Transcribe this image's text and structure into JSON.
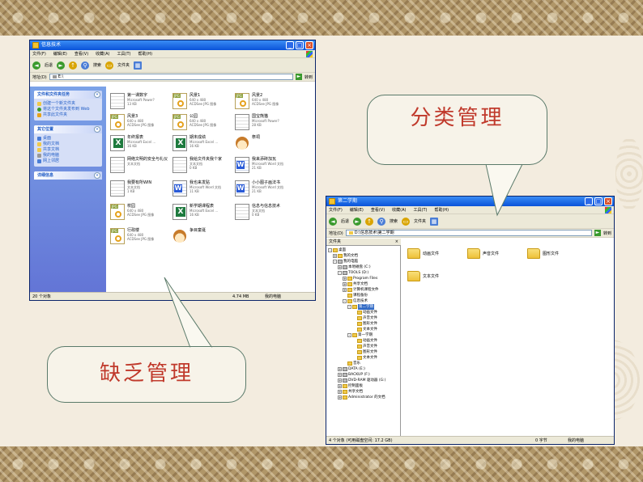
{
  "colors": {
    "band": "#b09668",
    "callout_text": "#c0392b",
    "titlebar": "#0a53d9"
  },
  "left_window": {
    "title": "信息技术",
    "menu": [
      "文件(F)",
      "编辑(E)",
      "查看(V)",
      "收藏(A)",
      "工具(T)",
      "帮助(H)"
    ],
    "toolbar": {
      "back": "后退",
      "search": "搜索",
      "folders": "文件夹"
    },
    "address": {
      "label": "地址(D)",
      "value": "E:\\",
      "go": "转到"
    },
    "tasks": {
      "file_tasks_title": "文件和文件夹任务",
      "file_tasks": [
        "创建一个新文件夹",
        "将这个文件夹发布到 Web",
        "共享此文件夹"
      ],
      "other_title": "其它位置",
      "other": [
        "桌面",
        "我的文档",
        "共享文档",
        "我的电脑",
        "网上邻居"
      ],
      "details_title": "详细信息"
    },
    "files": [
      {
        "name": "第一课数字",
        "sub": "Microsoft Power?\n13 KB",
        "icon": "ppt"
      },
      {
        "name": "风景1",
        "sub": "640 x 480\nACDSee JPG 图像",
        "icon": "jpg"
      },
      {
        "name": "风景2",
        "sub": "640 x 480\nACDSee JPG 图像",
        "icon": "jpg"
      },
      {
        "name": "风景3",
        "sub": "640 x 480\nACDSee JPG 图像",
        "icon": "jpg"
      },
      {
        "name": "公园",
        "sub": "640 x 480\nACDSee JPG 图像",
        "icon": "jpg"
      },
      {
        "name": "国宝熊猫",
        "sub": "Microsoft Power?\n28 KB",
        "icon": "ppt"
      },
      {
        "name": "年终报表",
        "sub": "Microsoft Excel ...\n16 KB",
        "icon": "xls"
      },
      {
        "name": "期末成绩",
        "sub": "Microsoft Excel ...\n16 KB",
        "icon": "xls"
      },
      {
        "name": "祭祠",
        "sub": "",
        "icon": "face"
      },
      {
        "name": "网络文明的安全与礼仪",
        "sub": "文本文档",
        "icon": "ppt"
      },
      {
        "name": "我给文件夹我个家",
        "sub": "文本文档\n0 KB",
        "icon": "ppt"
      },
      {
        "name": "我来添砖加瓦",
        "sub": "Microsoft Word 文档\n21 KB",
        "icon": "doc"
      },
      {
        "name": "我要有所WIN",
        "sub": "文本文档\n1 KB",
        "icon": "ppt"
      },
      {
        "name": "我也来发贴",
        "sub": "Microsoft Word 文档\n11 KB",
        "icon": "doc"
      },
      {
        "name": "小小图子画法书",
        "sub": "Microsoft Word 文档\n21 KB",
        "icon": "doc"
      },
      {
        "name": "校园",
        "sub": "640 x 480\nACDSee JPG 图像",
        "icon": "jpg"
      },
      {
        "name": "新学期课程表",
        "sub": "Microsoft Excel ...\n16 KB",
        "icon": "xls"
      },
      {
        "name": "信息与信息技术",
        "sub": "文本文档\n0 KB",
        "icon": "ppt"
      },
      {
        "name": "行政楼",
        "sub": "640 x 480\nACDSee JPG 图像",
        "icon": "jpg"
      },
      {
        "name": "争目童诞",
        "sub": "",
        "icon": "face"
      }
    ],
    "status": {
      "count": "20 个对象",
      "size": "4.74 MB",
      "location": "我的电脑"
    }
  },
  "right_window": {
    "title": "第二学期",
    "menu": [
      "文件(F)",
      "编辑(E)",
      "查看(V)",
      "收藏(A)",
      "工具(T)",
      "帮助(H)"
    ],
    "toolbar": {
      "back": "后退",
      "search": "搜索",
      "folders": "文件夹"
    },
    "address": {
      "label": "地址(D)",
      "value": "D:\\信息技术\\第二学期",
      "go": "转到"
    },
    "tree_title": "文件夹",
    "tree": [
      {
        "label": "桌面",
        "level": 0,
        "icon": "fd",
        "pm": "-"
      },
      {
        "label": "我的文档",
        "level": 1,
        "icon": "fd",
        "pm": "+"
      },
      {
        "label": "我的电脑",
        "level": 1,
        "icon": "dv",
        "pm": "-"
      },
      {
        "label": "本地磁盘 (C:)",
        "level": 2,
        "icon": "dv",
        "pm": "+"
      },
      {
        "label": "TOOLS (D:)",
        "level": 2,
        "icon": "dv",
        "pm": "-"
      },
      {
        "label": "Program Files",
        "level": 3,
        "icon": "fd",
        "pm": "+"
      },
      {
        "label": "共享文档",
        "level": 3,
        "icon": "fd",
        "pm": "+"
      },
      {
        "label": "计算机课程文件",
        "level": 3,
        "icon": "fd",
        "pm": "+"
      },
      {
        "label": "课程备份",
        "level": 3,
        "icon": "fd",
        "pm": ""
      },
      {
        "label": "信息技术",
        "level": 3,
        "icon": "fd",
        "pm": "-"
      },
      {
        "label": "第二学期",
        "level": 4,
        "icon": "fd",
        "pm": "-",
        "sel": true
      },
      {
        "label": "动画文件",
        "level": 5,
        "icon": "fd",
        "pm": ""
      },
      {
        "label": "声音文件",
        "level": 5,
        "icon": "fd",
        "pm": ""
      },
      {
        "label": "图形文件",
        "level": 5,
        "icon": "fd",
        "pm": ""
      },
      {
        "label": "文本文件",
        "level": 5,
        "icon": "fd",
        "pm": ""
      },
      {
        "label": "第一学期",
        "level": 4,
        "icon": "fd",
        "pm": "-"
      },
      {
        "label": "动画文件",
        "level": 5,
        "icon": "fd",
        "pm": ""
      },
      {
        "label": "声音文件",
        "level": 5,
        "icon": "fd",
        "pm": ""
      },
      {
        "label": "图形文件",
        "level": 5,
        "icon": "fd",
        "pm": ""
      },
      {
        "label": "文本文件",
        "level": 5,
        "icon": "fd",
        "pm": ""
      },
      {
        "label": "音乐",
        "level": 3,
        "icon": "fd",
        "pm": ""
      },
      {
        "label": "DATA (E:)",
        "level": 2,
        "icon": "dv",
        "pm": "+"
      },
      {
        "label": "BACKUP (F:)",
        "level": 2,
        "icon": "dv",
        "pm": "+"
      },
      {
        "label": "DVD-RAM 驱动器 (G:)",
        "level": 2,
        "icon": "dv",
        "pm": "+"
      },
      {
        "label": "控制面板",
        "level": 2,
        "icon": "fd",
        "pm": "+"
      },
      {
        "label": "共享文档",
        "level": 2,
        "icon": "fd",
        "pm": "+"
      },
      {
        "label": "Administrator 的文档",
        "level": 2,
        "icon": "fd",
        "pm": "+"
      }
    ],
    "folders": [
      "动画文件",
      "声音文件",
      "图形文件",
      "文本文件"
    ],
    "status": {
      "count": "4 个对象 (可用磁盘空间: 17.2 GB)",
      "size": "0 字节",
      "location": "我的电脑"
    }
  },
  "callouts": {
    "left": "缺乏管理",
    "right": "分类管理"
  }
}
